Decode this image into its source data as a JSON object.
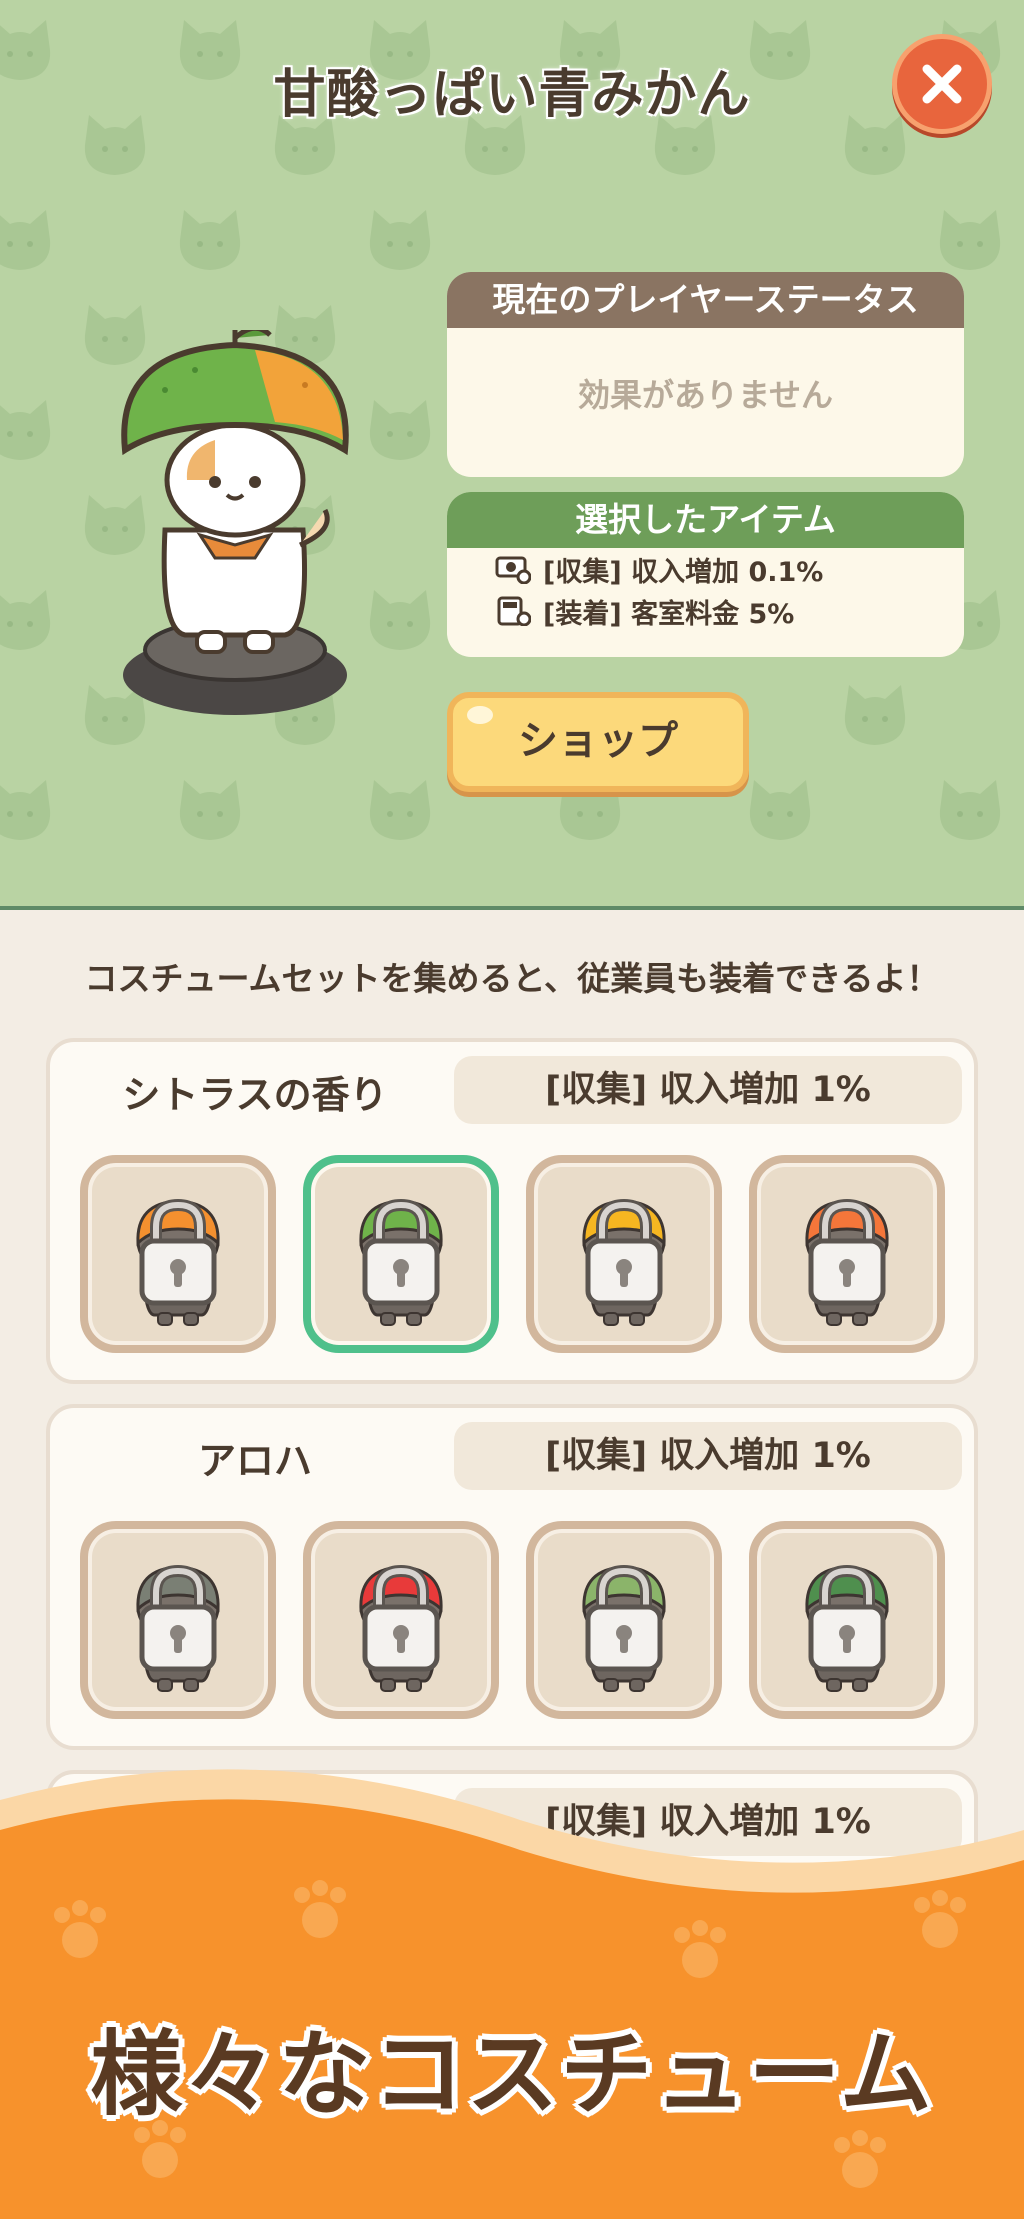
{
  "header": {
    "title": "甘酸っぱい青みかん",
    "close_icon": "close-icon"
  },
  "status_panel": {
    "title": "現在のプレイヤーステータス",
    "body": "効果がありません"
  },
  "selected_panel": {
    "title": "選択したアイテム",
    "effects": [
      {
        "icon": "money-icon",
        "text": "[収集] 収入増加 0.1%"
      },
      {
        "icon": "register-icon",
        "text": "[装着] 客室料金 5%"
      }
    ]
  },
  "shop_button": {
    "label": "ショップ"
  },
  "hint": "コスチュームセットを集めると、従業員も装着できるよ！",
  "sets": [
    {
      "name": "シトラスの香り",
      "bonus": "[収集] 収入増加 1%",
      "items": [
        {
          "hat_color": "#f4902f",
          "locked": true,
          "selected": false
        },
        {
          "hat_color": "#6fb34a",
          "locked": true,
          "selected": true
        },
        {
          "hat_color": "#f6b621",
          "locked": true,
          "selected": false
        },
        {
          "hat_color": "#f4763a",
          "locked": true,
          "selected": false
        }
      ]
    },
    {
      "name": "アロハ",
      "bonus": "[収集] 収入増加 1%",
      "items": [
        {
          "hat_color": "#7a7f74",
          "locked": true,
          "selected": false
        },
        {
          "hat_color": "#e83a3a",
          "locked": true,
          "selected": false
        },
        {
          "hat_color": "#8bb46a",
          "locked": true,
          "selected": false
        },
        {
          "hat_color": "#4f8f4e",
          "locked": true,
          "selected": false
        }
      ]
    },
    {
      "name": "",
      "bonus": "[収集] 収入増加 1%",
      "items": []
    }
  ],
  "banner": {
    "text": "様々なコスチューム"
  },
  "colors": {
    "top_bg": "#b9d3a3",
    "status_head": "#8a7462",
    "selected_head": "#6e9e59",
    "shop_button": "#fcd97b",
    "selected_slot": "#4fc08b",
    "banner": "#f7922c"
  }
}
